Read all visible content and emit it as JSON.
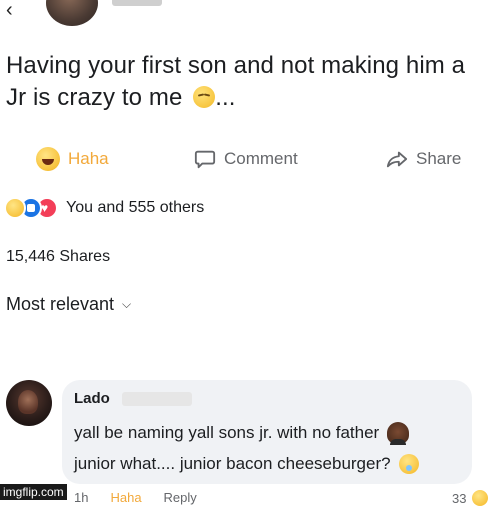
{
  "post": {
    "text": "Having your first son and not making him a Jr is crazy to me",
    "text_ellipsis": "..."
  },
  "actions": {
    "haha_label": "Haha",
    "comment_label": "Comment",
    "share_label": "Share"
  },
  "reactions": {
    "summary": "You and 555 others"
  },
  "shares": {
    "count_text": "15,446 Shares"
  },
  "sort": {
    "label": "Most relevant"
  },
  "comment": {
    "author": "Lado",
    "line1": "yall be naming yall sons jr. with no father",
    "line2": "junior what.... junior bacon cheeseburger?",
    "time": "1h",
    "haha_label": "Haha",
    "reply_label": "Reply",
    "reaction_count": "33"
  },
  "watermark": "imgflip.com",
  "icons": [
    "back-arrow-icon",
    "haha-icon",
    "comment-icon",
    "share-icon",
    "like-icon",
    "love-icon",
    "chevron-down-icon"
  ],
  "colors": {
    "haha_accent": "#f2a93b",
    "secondary_text": "#65676b",
    "bubble_bg": "#f0f2f5",
    "like_blue": "#1b74e4",
    "love_red": "#f33e58"
  }
}
